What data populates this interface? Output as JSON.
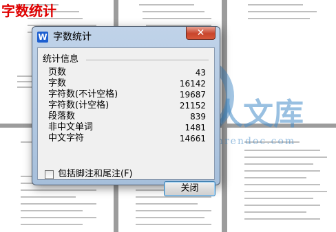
{
  "app_title": "字数统计",
  "dialog": {
    "title": "字数统计",
    "close_label": "✕",
    "group_label": "统计信息",
    "stats": [
      {
        "label": "页数",
        "value": "43"
      },
      {
        "label": "字数",
        "value": "16142"
      },
      {
        "label": "字符数(不计空格)",
        "value": "19687"
      },
      {
        "label": "字符数(计空格)",
        "value": "21152"
      },
      {
        "label": "段落数",
        "value": "839"
      },
      {
        "label": "非中文单词",
        "value": "1481"
      },
      {
        "label": "中文字符",
        "value": "14661"
      }
    ],
    "checkbox_label": "包括脚注和尾注(F)",
    "checkbox_checked": false,
    "close_button_label": "关闭"
  },
  "watermark": {
    "text": "人人文库",
    "url": "renrendoc.com"
  },
  "colors": {
    "app_title": "#e00000",
    "close_button": "#c8452c",
    "dialog_frame": "#a6bfdb"
  }
}
